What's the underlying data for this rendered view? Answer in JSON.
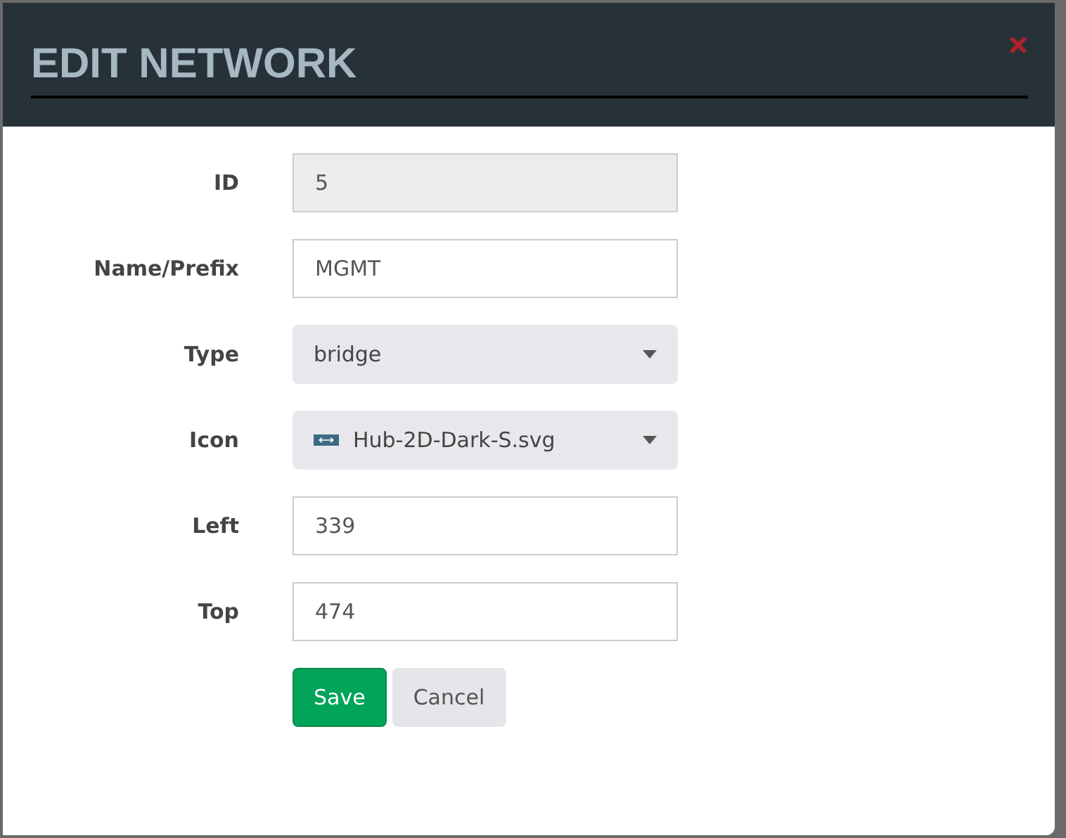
{
  "dialog": {
    "title": "EDIT NETWORK"
  },
  "fields": [
    {
      "label": "ID",
      "kind": "text",
      "value": "5",
      "disabled": true
    },
    {
      "label": "Name/Prefix",
      "kind": "text",
      "value": "MGMT",
      "disabled": false
    },
    {
      "label": "Type",
      "kind": "select",
      "value": "bridge",
      "disabled": false
    },
    {
      "label": "Icon",
      "kind": "icon-select",
      "value": "Hub-2D-Dark-S.svg",
      "disabled": false
    },
    {
      "label": "Left",
      "kind": "text",
      "value": "339",
      "disabled": false
    },
    {
      "label": "Top",
      "kind": "text",
      "value": "474",
      "disabled": false
    }
  ],
  "buttons": [
    {
      "label": "Save",
      "kind": "primary"
    },
    {
      "label": "Cancel",
      "kind": "secondary"
    }
  ]
}
